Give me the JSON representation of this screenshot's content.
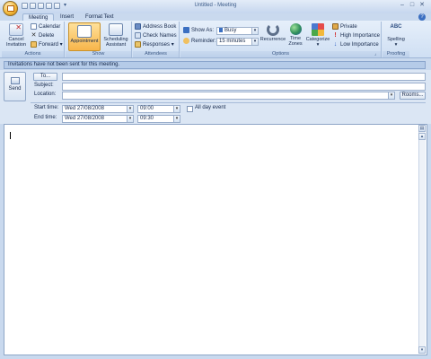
{
  "window": {
    "title": "Untitled - Meeting",
    "minimize": "–",
    "maximize": "□",
    "close": "✕"
  },
  "tabs": [
    {
      "label": "Meeting",
      "active": true
    },
    {
      "label": "Insert",
      "active": false
    },
    {
      "label": "Format Text",
      "active": false
    }
  ],
  "ribbon": {
    "actions": {
      "label": "Actions",
      "cancel_invitation": "Cancel\nInvitation",
      "calendar": "Calendar",
      "delete": "Delete",
      "forward": "Forward"
    },
    "show": {
      "label": "Show",
      "appointment": "Appointment",
      "scheduling": "Scheduling\nAssistant"
    },
    "attendees": {
      "label": "Attendees",
      "address_book": "Address Book",
      "check_names": "Check Names",
      "responses": "Responses"
    },
    "options": {
      "label": "Options",
      "show_as_label": "Show As:",
      "show_as_value": "Busy",
      "reminder_label": "Reminder:",
      "reminder_value": "15 minutes",
      "recurrence": "Recurrence",
      "time_zones": "Time\nZones",
      "categorize": "Categorize",
      "private": "Private",
      "high_importance": "High Importance",
      "low_importance": "Low Importance"
    },
    "proofing": {
      "label": "Proofing",
      "spelling": "Spelling",
      "spelling_icon_text": "ABC"
    }
  },
  "infobar": "Invitations have not been sent for this meeting.",
  "form": {
    "send": "Send",
    "to_button": "To...",
    "subject_label": "Subject:",
    "location_label": "Location:",
    "rooms_button": "Rooms...",
    "start_label": "Start time:",
    "start_date": "Wed 27/08/2008",
    "start_time": "09:00",
    "all_day_label": "All day event",
    "end_label": "End time:",
    "end_date": "Wed 27/08/2008",
    "end_time": "09:30"
  },
  "colors": {
    "ribbon_bg": "#dbe7f7",
    "appointment_active": "#f7b54a",
    "accent": "#3b6fc1"
  }
}
